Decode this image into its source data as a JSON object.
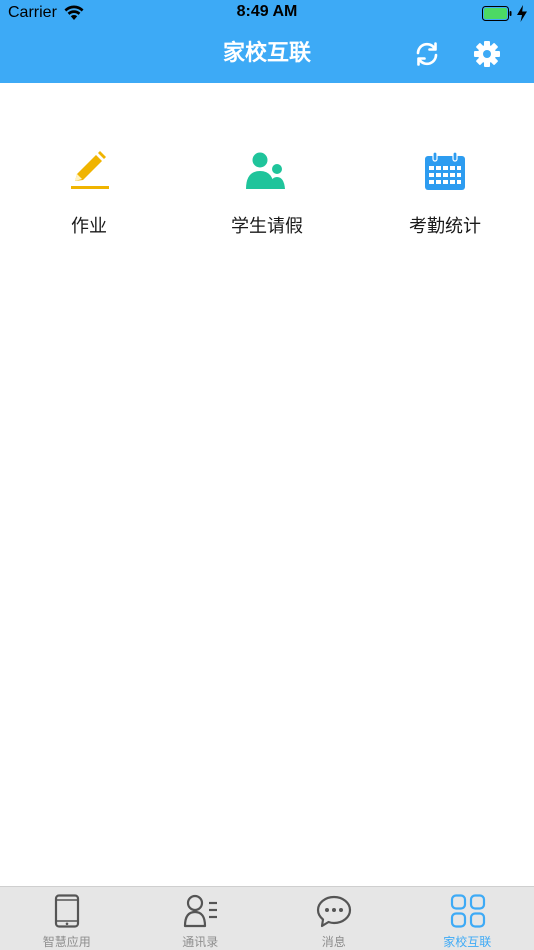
{
  "status_bar": {
    "carrier": "Carrier",
    "time": "8:49 AM"
  },
  "nav": {
    "title": "家校互联",
    "background": "#3daaf6"
  },
  "menu": {
    "items": [
      {
        "label": "作业",
        "icon": "pencil-icon",
        "color": "#f0b400"
      },
      {
        "label": "学生请假",
        "icon": "students-icon",
        "color": "#1fc49b"
      },
      {
        "label": "考勤统计",
        "icon": "calendar-icon",
        "color": "#2d9cf0"
      }
    ]
  },
  "tabs": [
    {
      "label": "智慧应用",
      "icon": "tablet-icon",
      "active": false
    },
    {
      "label": "通讯录",
      "icon": "contacts-icon",
      "active": false
    },
    {
      "label": "消息",
      "icon": "chat-icon",
      "active": false
    },
    {
      "label": "家校互联",
      "icon": "grid-icon",
      "active": true
    }
  ],
  "colors": {
    "accent": "#3daaf6",
    "tab_inactive": "#8e8e8e"
  }
}
